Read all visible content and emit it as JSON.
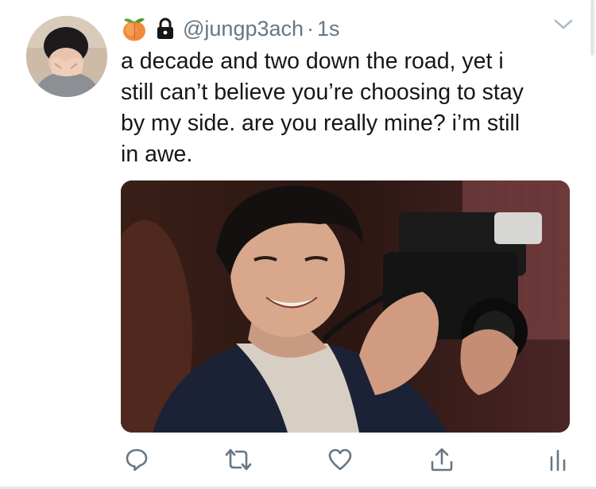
{
  "tweet": {
    "handle": "@jungp3ach",
    "separator": "·",
    "time": "1s",
    "text": "a decade and two down the road, yet i\nstill can’t believe you’re choosing to stay\nby my side. are you really mine? i’m still\nin awe."
  },
  "icons": {
    "name_emoji": "peach-emoji-icon",
    "protected": "lock-icon",
    "menu": "chevron-down-icon",
    "reply": "reply-icon",
    "retweet": "retweet-icon",
    "like": "heart-icon",
    "share": "share-icon",
    "analytics": "analytics-icon"
  },
  "colors": {
    "text": "#14171a",
    "secondary": "#657786",
    "icon": "#657786",
    "divider": "#e1e8ed"
  }
}
